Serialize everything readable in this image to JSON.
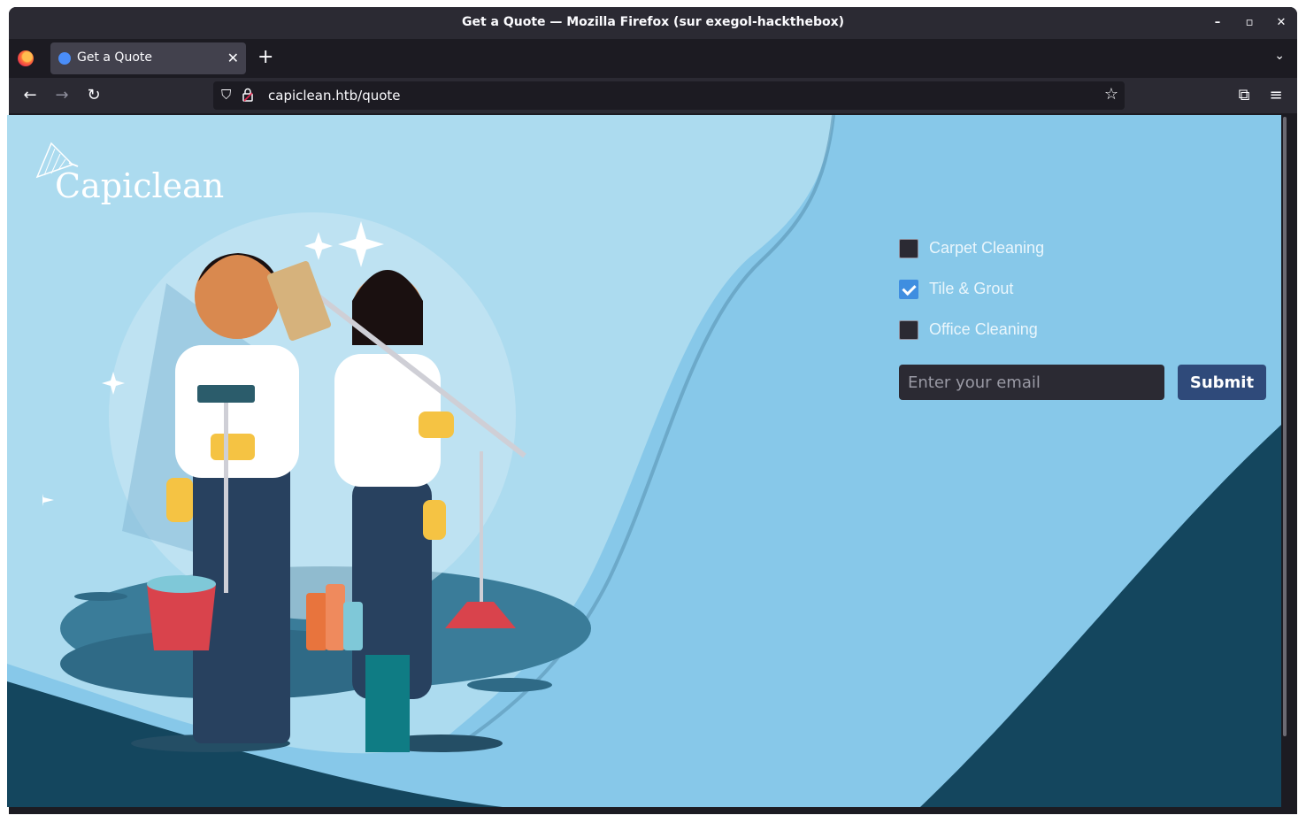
{
  "window": {
    "title": "Get a Quote — Mozilla Firefox (sur exegol-hackthebox)",
    "minimize_glyph": "–",
    "maximize_glyph": "▫",
    "close_glyph": "✕"
  },
  "tab": {
    "label": "Get a Quote",
    "close_glyph": "✕",
    "new_tab_glyph": "+",
    "list_glyph": "⌄"
  },
  "nav": {
    "back_glyph": "←",
    "forward_glyph": "→",
    "reload_glyph": "↻",
    "url": "capiclean.htb/quote",
    "shield_glyph": "⛉",
    "bookmark_glyph": "☆",
    "extensions_glyph": "⧉",
    "menu_glyph": "≡"
  },
  "page": {
    "logo_text": "Capiclean",
    "services": [
      {
        "label": "Carpet Cleaning",
        "checked": false
      },
      {
        "label": "Tile & Grout",
        "checked": true
      },
      {
        "label": "Office Cleaning",
        "checked": false
      }
    ],
    "email_placeholder": "Enter your email",
    "submit_label": "Submit"
  },
  "colors": {
    "page_background": "#87c8e9",
    "dark_wave": "#14465e",
    "light_wave": "#acdbef",
    "submit_button": "#2f4a7a",
    "checkbox_accent": "#3f8ee0"
  }
}
